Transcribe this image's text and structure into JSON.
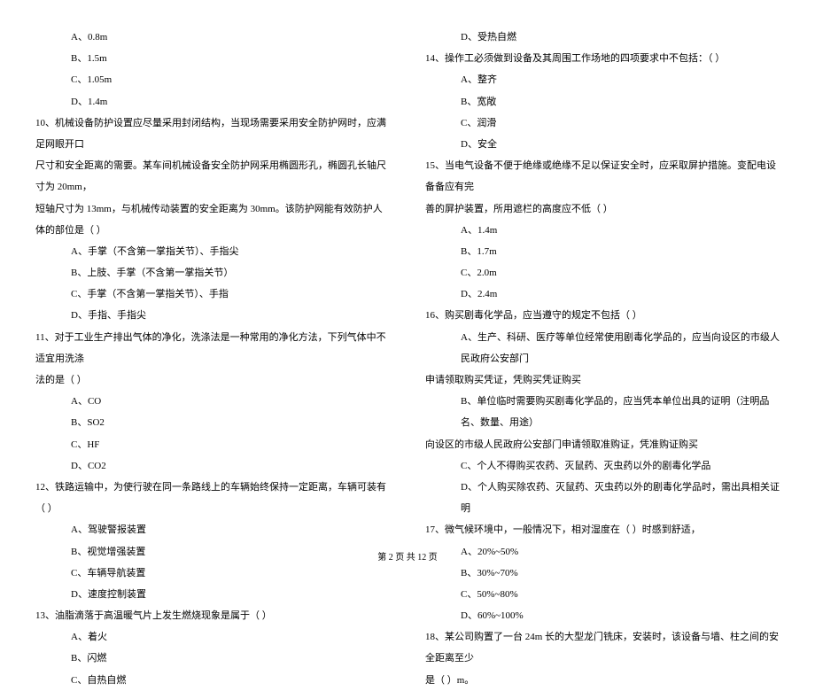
{
  "left_column": {
    "q9_options": [
      "A、0.8m",
      "B、1.5m",
      "C、1.05m",
      "D、1.4m"
    ],
    "q10": {
      "text_line1": "10、机械设备防护设置应尽量采用封闭结构，当现场需要采用安全防护网时，应满足网眼开口",
      "text_line2": "尺寸和安全距离的需要。某车间机械设备安全防护网采用椭圆形孔，椭圆孔长轴尺寸为 20mm，",
      "text_line3": "短轴尺寸为 13mm，与机械传动装置的安全距离为 30mm。该防护网能有效防护人体的部位是（    ）",
      "options": [
        "A、手掌（不含第一掌指关节）、手指尖",
        "B、上肢、手掌（不含第一掌指关节）",
        "C、手掌（不含第一掌指关节）、手指",
        "D、手指、手指尖"
      ]
    },
    "q11": {
      "text_line1": "11、对于工业生产排出气体的净化，洗涤法是一种常用的净化方法，下列气体中不适宜用洗涤",
      "text_line2": "法的是（    ）",
      "options": [
        "A、CO",
        "B、SO2",
        "C、HF",
        "D、CO2"
      ]
    },
    "q12": {
      "text": "12、铁路运输中，为使行驶在同一条路线上的车辆始终保持一定距离，车辆可装有（    ）",
      "options": [
        "A、驾驶警报装置",
        "B、视觉增强装置",
        "C、车辆导航装置",
        "D、速度控制装置"
      ]
    },
    "q13": {
      "text": "13、油脂滴落于高温暖气片上发生燃烧现象是属于（    ）",
      "options": [
        "A、着火",
        "B、闪燃",
        "C、自热自燃"
      ]
    }
  },
  "right_column": {
    "q13_option_d": "D、受热自燃",
    "q14": {
      "text": "14、操作工必须做到设备及其周围工作场地的四项要求中不包括：（    ）",
      "options": [
        "A、整齐",
        "B、宽敞",
        "C、润滑",
        "D、安全"
      ]
    },
    "q15": {
      "text_line1": "15、当电气设备不便于绝缘或绝缘不足以保证安全时，应采取屏护措施。变配电设备备应有完",
      "text_line2": "善的屏护装置，所用遮栏的高度应不低（    ）",
      "options": [
        "A、1.4m",
        "B、1.7m",
        "C、2.0m",
        "D、2.4m"
      ]
    },
    "q16": {
      "text": "16、购买剧毒化学品，应当遵守的规定不包括（    ）",
      "option_a_line1": "A、生产、科研、医疗等单位经常使用剧毒化学品的，应当向设区的市级人民政府公安部门",
      "option_a_line2": "申请领取购买凭证，凭购买凭证购买",
      "option_b_line1": "B、单位临时需要购买剧毒化学品的，应当凭本单位出具的证明（注明品名、数量、用途）",
      "option_b_line2": "向设区的市级人民政府公安部门申请领取准购证，凭准购证购买",
      "option_c": "C、个人不得购买农药、灭鼠药、灭虫药以外的剧毒化学品",
      "option_d": "D、个人购买除农药、灭鼠药、灭虫药以外的剧毒化学品时，需出具相关证明 "
    },
    "q17": {
      "text": "17、微气候环境中，一般情况下，相对湿度在（    ）时感到舒适，",
      "options": [
        "A、20%~50%",
        "B、30%~70%",
        "C、50%~80%",
        "D、60%~100%"
      ]
    },
    "q18": {
      "text_line1": "18、某公司购置了一台 24m 长的大型龙门铣床，安装时，该设备与墙、柱之间的安全距离至少",
      "text_line2": "是（    ）m。"
    }
  },
  "footer": "第 2 页 共 12 页"
}
